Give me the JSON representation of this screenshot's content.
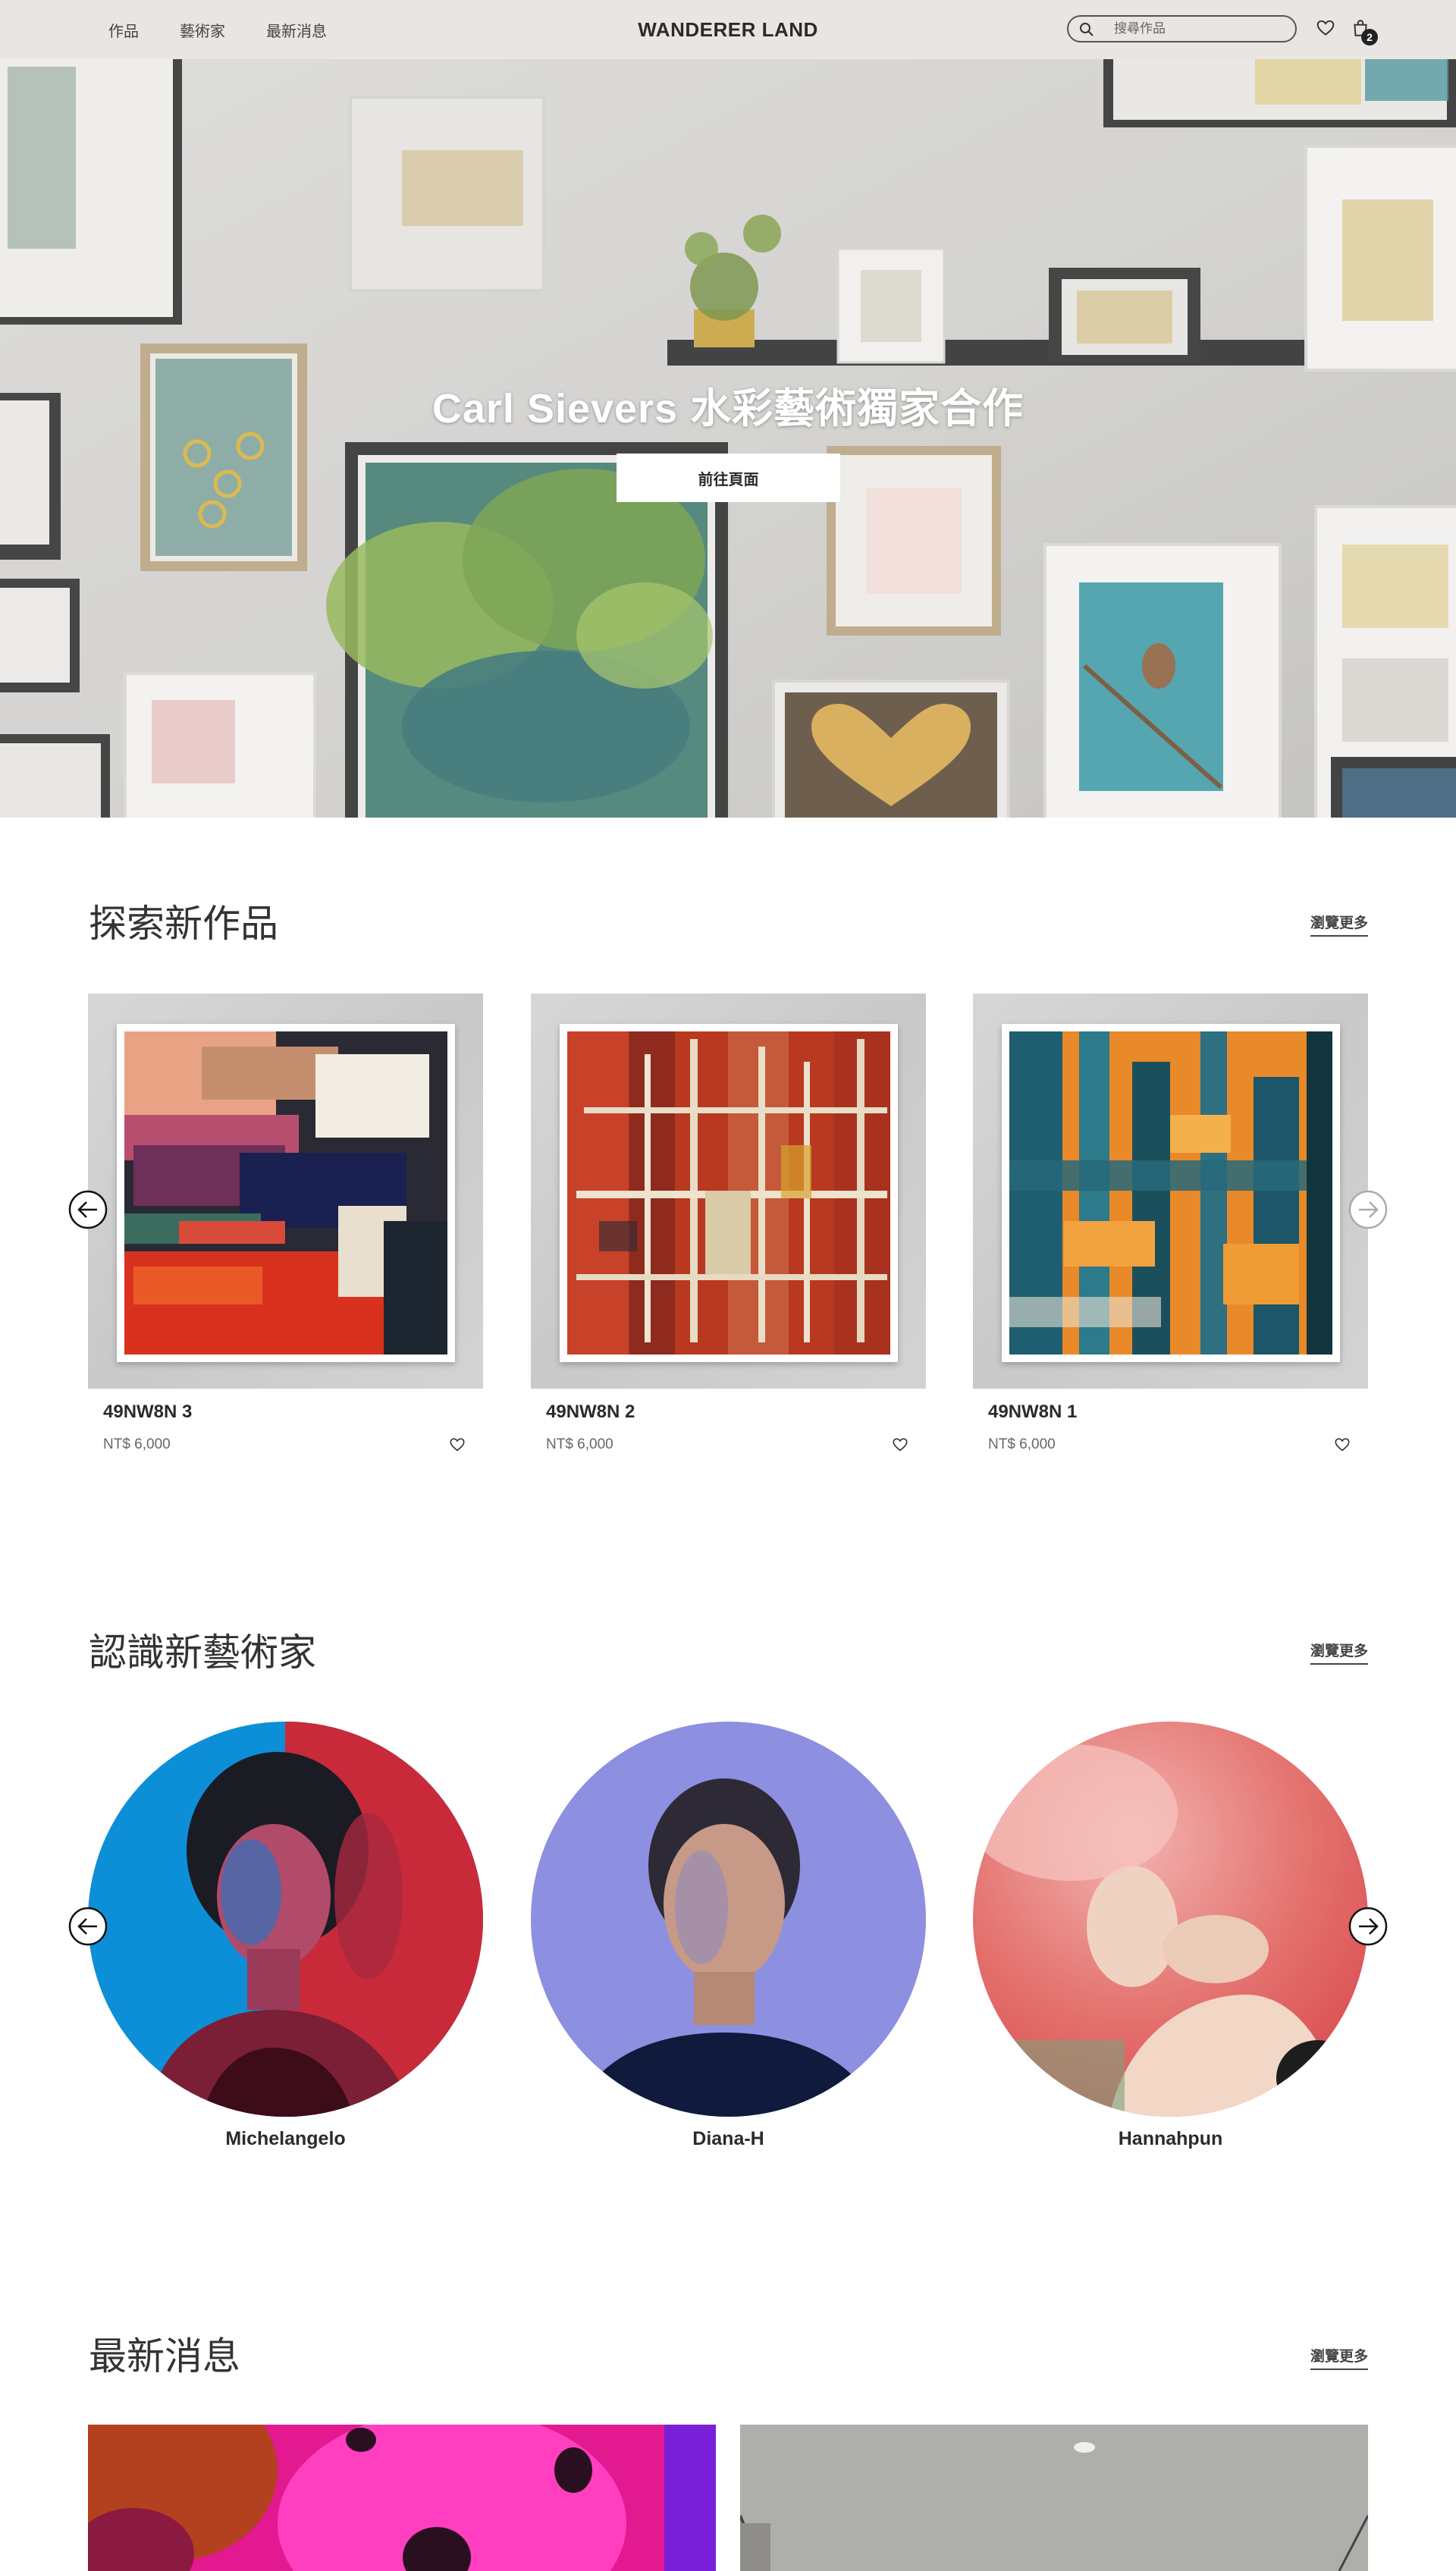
{
  "header": {
    "nav": [
      "作品",
      "藝術家",
      "最新消息"
    ],
    "brand": "WANDERER LAND",
    "search_placeholder": "搜尋作品",
    "cart_count": "2"
  },
  "hero": {
    "title": "Carl Sievers 水彩藝術獨家合作",
    "button": "前往頁面"
  },
  "artworks_section": {
    "title": "探索新作品",
    "more": "瀏覽更多",
    "items": [
      {
        "name": "49NW8N 3",
        "price": "NT$ 6,000"
      },
      {
        "name": "49NW8N 2",
        "price": "NT$ 6,000"
      },
      {
        "name": "49NW8N 1",
        "price": "NT$ 6,000"
      }
    ]
  },
  "artists_section": {
    "title": "認識新藝術家",
    "more": "瀏覽更多",
    "items": [
      {
        "name": "Michelangelo"
      },
      {
        "name": "Diana-H"
      },
      {
        "name": "Hannahpun"
      }
    ]
  },
  "news_section": {
    "title": "最新消息",
    "more": "瀏覽更多"
  },
  "colors": {
    "header_bg": "#e8e5e2",
    "text": "#2b2b2b",
    "muted": "#666666"
  },
  "icons": [
    "search-icon",
    "heart-icon",
    "shopping-bag-icon",
    "arrow-left-icon",
    "arrow-right-icon"
  ]
}
